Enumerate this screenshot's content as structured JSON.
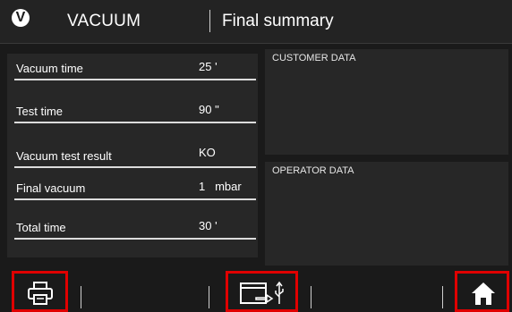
{
  "header": {
    "logo_letter": "V",
    "app_title": "VACUUM",
    "page_title": "Final summary"
  },
  "summary": [
    {
      "label": "Vacuum time",
      "value": "25 '"
    },
    {
      "label": "Test time",
      "value": "90 \""
    },
    {
      "label": "Vacuum test result",
      "value": "KO"
    },
    {
      "label": "Final vacuum",
      "value": "1   mbar"
    },
    {
      "label": "Total time",
      "value": "30 '"
    }
  ],
  "panels": {
    "customer_title": "CUSTOMER DATA",
    "operator_title": "OPERATOR DATA"
  },
  "footer": {
    "buttons": [
      {
        "name": "print",
        "icon": "printer-icon"
      },
      {
        "name": "usb-export",
        "icon": "usb-export-icon"
      },
      {
        "name": "home",
        "icon": "home-icon"
      }
    ],
    "highlight_color": "#e00000"
  }
}
